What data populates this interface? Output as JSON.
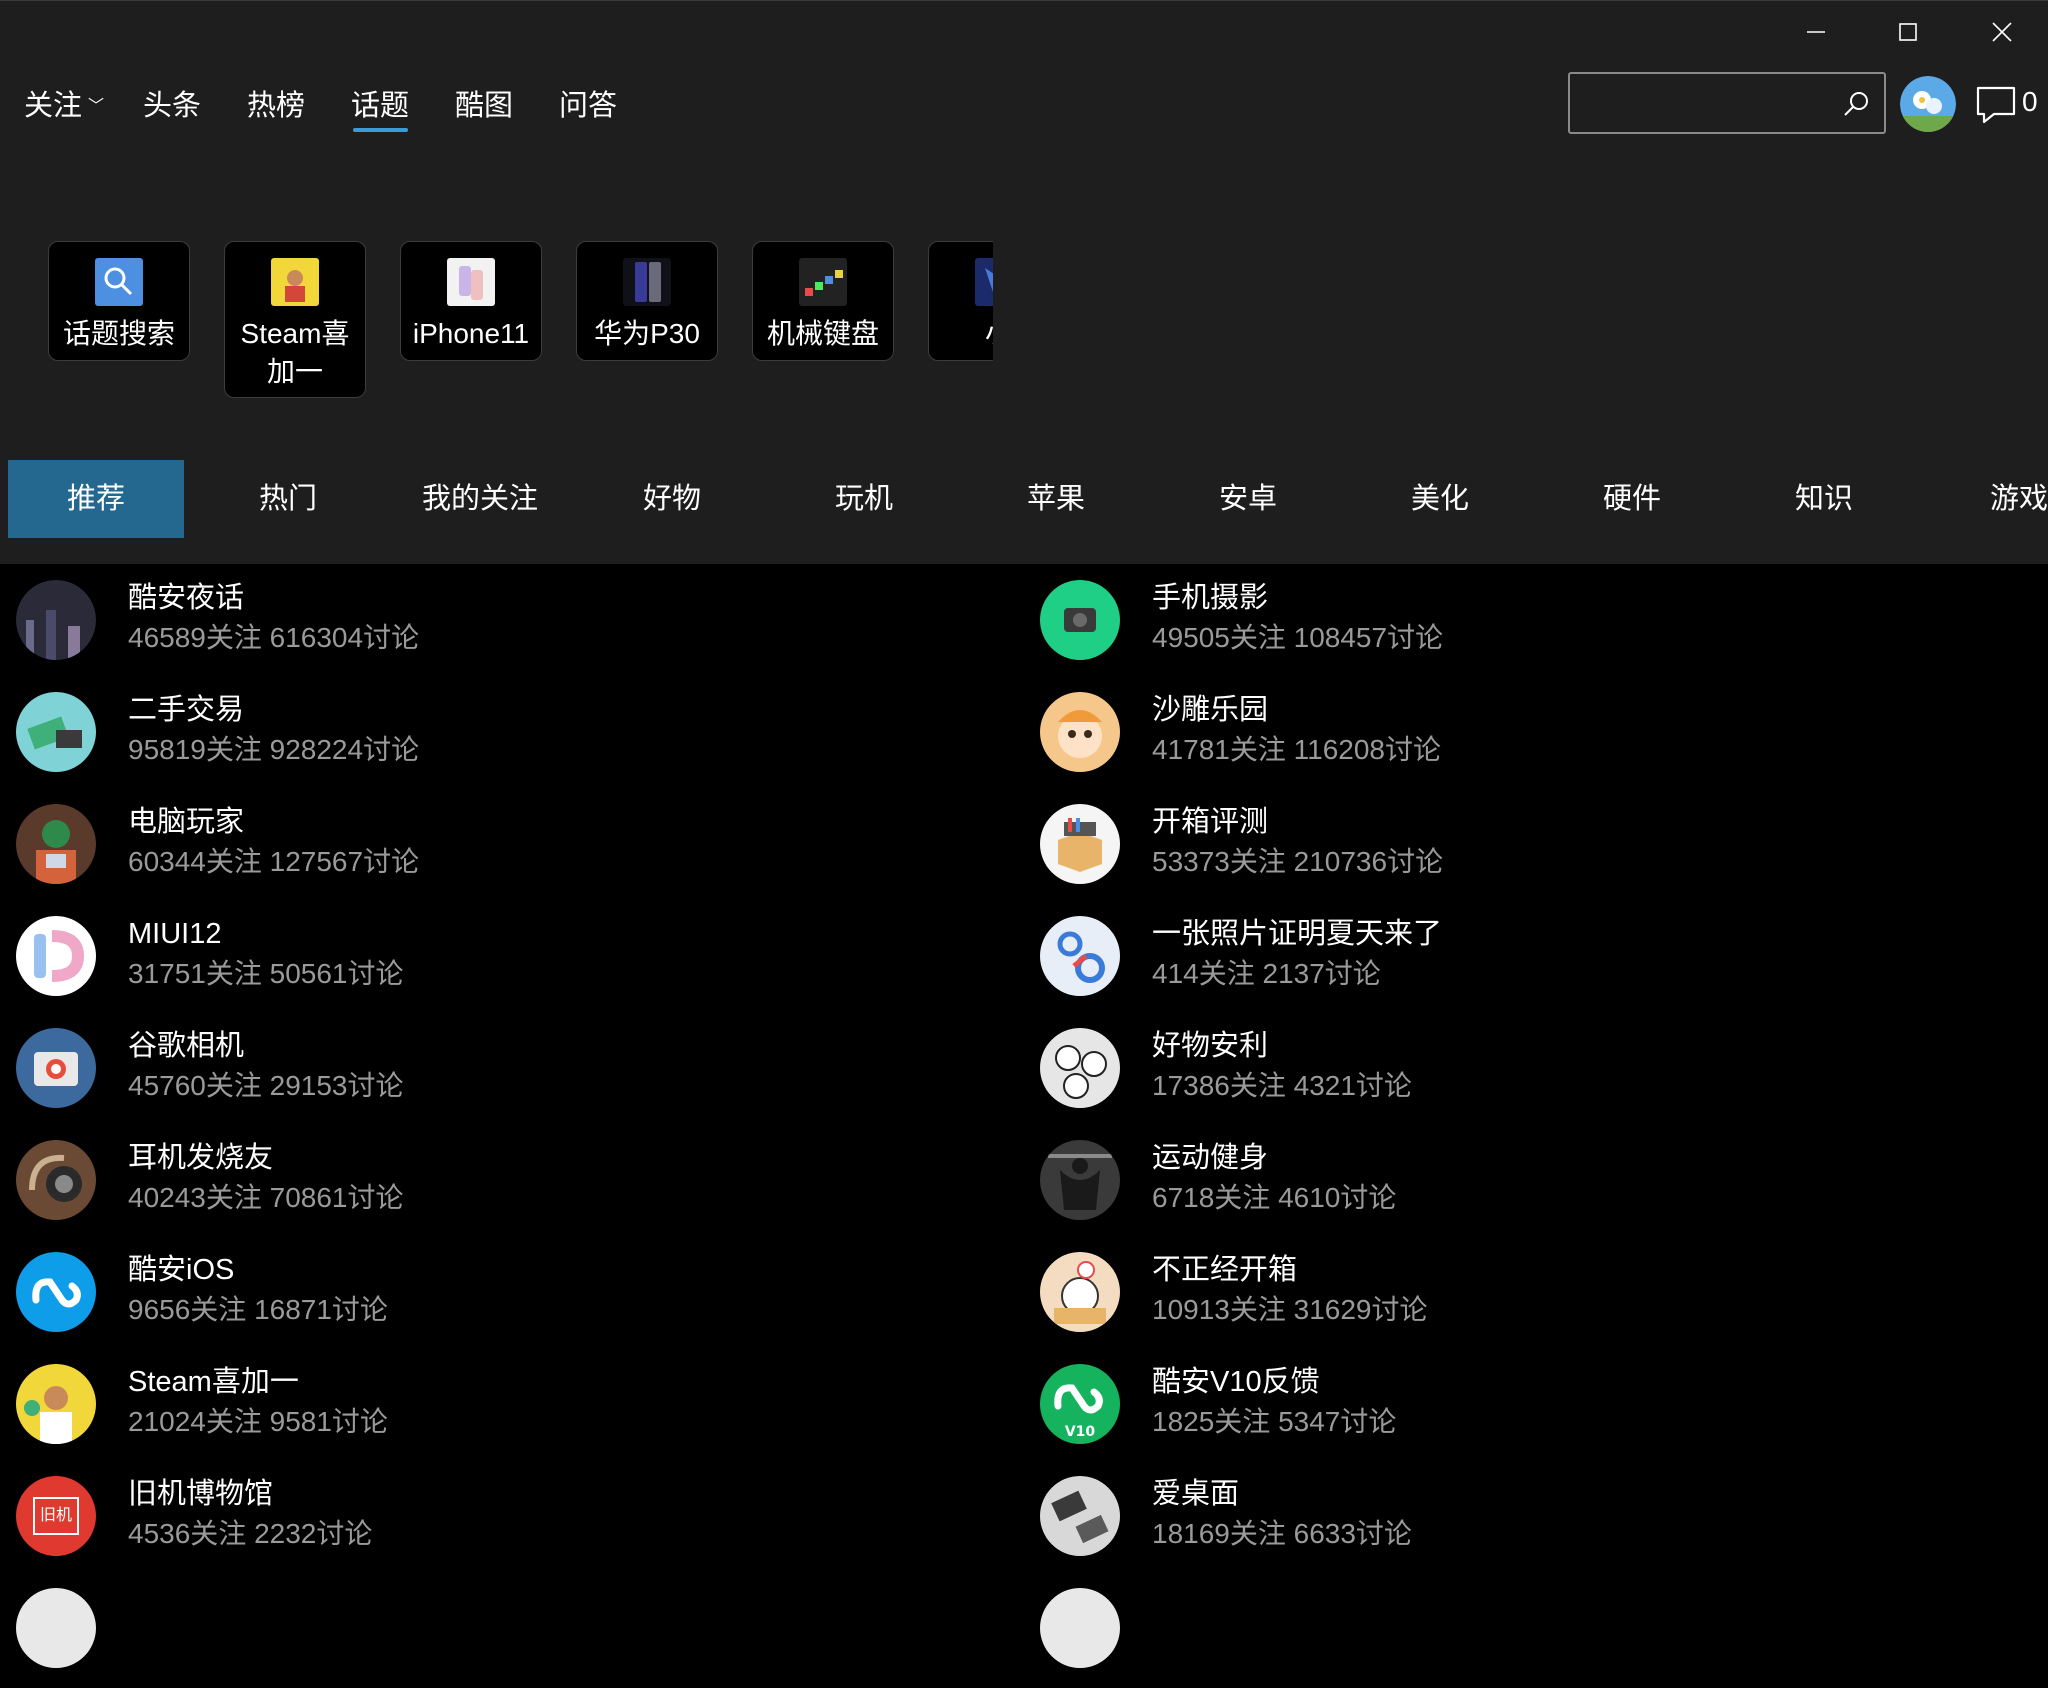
{
  "window": {
    "minimize_label": "minimize-icon",
    "maximize_label": "maximize-icon",
    "close_label": "close-icon"
  },
  "nav": {
    "items": [
      "关注",
      "头条",
      "热榜",
      "话题",
      "酷图",
      "问答"
    ],
    "active": "话题"
  },
  "search": {
    "placeholder": "",
    "value": ""
  },
  "messages": {
    "count": "0"
  },
  "tiles": [
    {
      "label": "话题搜索",
      "icon": "search-topic-icon"
    },
    {
      "label": "Steam喜加一",
      "icon": "steam-promo-icon"
    },
    {
      "label": "iPhone11",
      "icon": "iphone-icon"
    },
    {
      "label": "华为P30",
      "icon": "phone-icon"
    },
    {
      "label": "机械键盘",
      "icon": "keyboard-icon"
    },
    {
      "label": "小",
      "icon": "partial-icon"
    }
  ],
  "categories": [
    "推荐",
    "热门",
    "我的关注",
    "好物",
    "玩机",
    "苹果",
    "安卓",
    "美化",
    "硬件",
    "知识",
    "游戏"
  ],
  "topics_left": [
    {
      "name": "酷安夜话",
      "stats": "46589关注 616304讨论",
      "color": "#2a2a38"
    },
    {
      "name": "二手交易",
      "stats": "95819关注 928224讨论",
      "color": "#7fd3d6"
    },
    {
      "name": "电脑玩家",
      "stats": "60344关注 127567讨论",
      "color": "#5a3a2a"
    },
    {
      "name": "MIUI12",
      "stats": "31751关注 50561讨论",
      "color": "#ffffff"
    },
    {
      "name": "谷歌相机",
      "stats": "45760关注 29153讨论",
      "color": "#3d6a9e"
    },
    {
      "name": "耳机发烧友",
      "stats": "40243关注 70861讨论",
      "color": "#6b4a35"
    },
    {
      "name": "酷安iOS",
      "stats": "9656关注 16871讨论",
      "color": "#0e9de8"
    },
    {
      "name": "Steam喜加一",
      "stats": "21024关注 9581讨论",
      "color": "#f2d73a"
    },
    {
      "name": "旧机博物馆",
      "stats": "4536关注 2232讨论",
      "color": "#e0392f"
    }
  ],
  "topics_right": [
    {
      "name": "手机摄影",
      "stats": "49505关注 108457讨论",
      "color": "#1fcf85"
    },
    {
      "name": "沙雕乐园",
      "stats": "41781关注 116208讨论",
      "color": "#f5c78a"
    },
    {
      "name": "开箱评测",
      "stats": "53373关注 210736讨论",
      "color": "#f5f5f5"
    },
    {
      "name": "一张照片证明夏天来了",
      "stats": "414关注 2137讨论",
      "color": "#e8eef8"
    },
    {
      "name": "好物安利",
      "stats": "17386关注 4321讨论",
      "color": "#e6e6e6"
    },
    {
      "name": "运动健身",
      "stats": "6718关注 4610讨论",
      "color": "#3a3a3a"
    },
    {
      "name": "不正经开箱",
      "stats": "10913关注 31629讨论",
      "color": "#f4dcc0"
    },
    {
      "name": "酷安V10反馈",
      "stats": "1825关注 5347讨论",
      "color": "#16b35e"
    },
    {
      "name": "爱桌面",
      "stats": "18169关注 6633讨论",
      "color": "#d8d8d8"
    }
  ],
  "icon_texts": {
    "miui": "12",
    "old": "旧机",
    "v10": "V10"
  }
}
